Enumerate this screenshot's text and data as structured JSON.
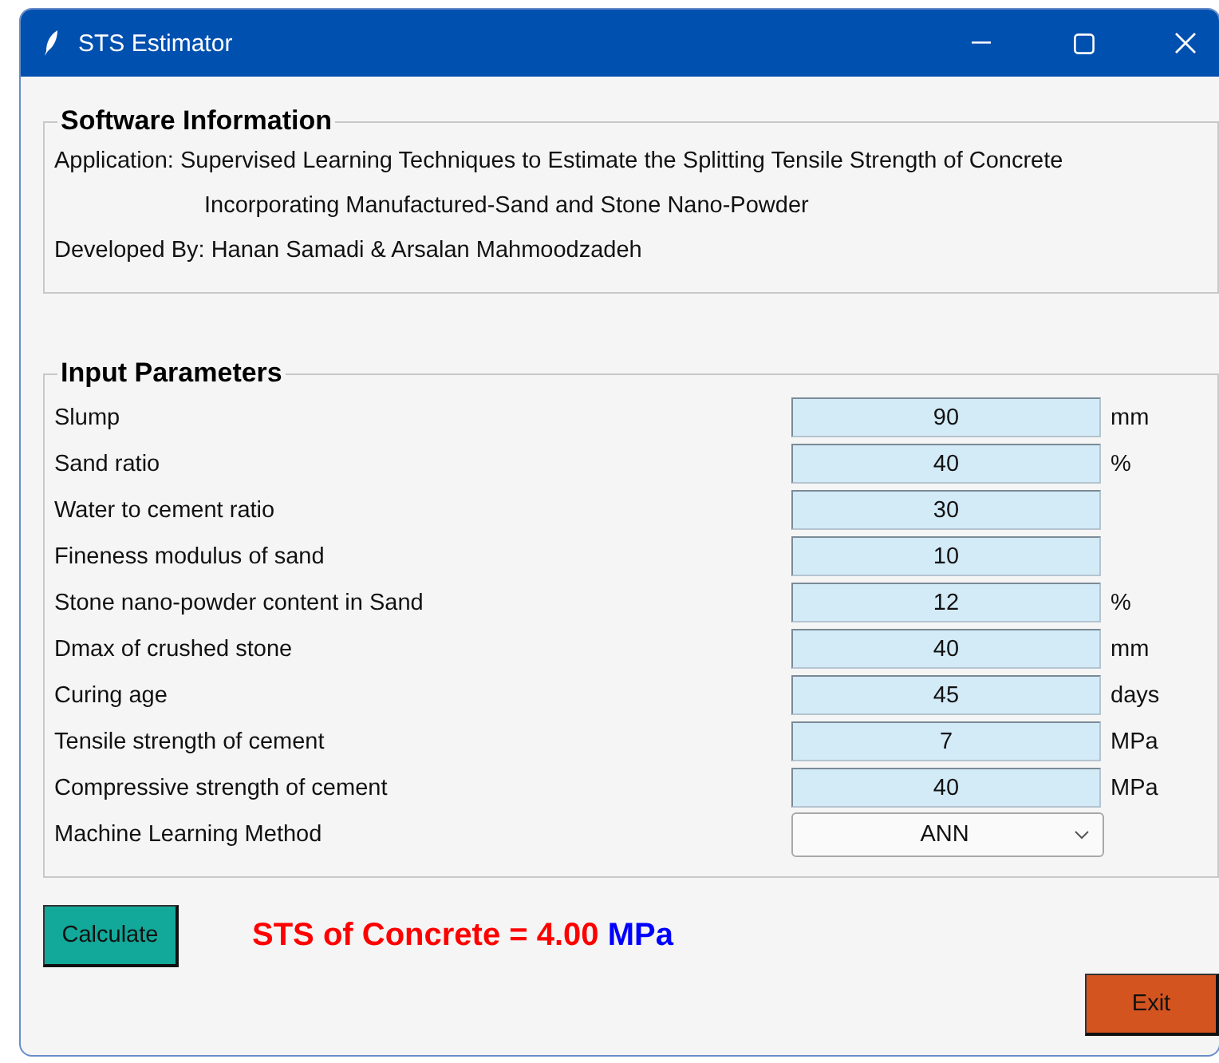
{
  "window": {
    "title": "STS Estimator"
  },
  "software_information": {
    "title": "Software Information",
    "lines": [
      {
        "kind": "first",
        "text": "Application: Supervised Learning Techniques to Estimate the Splitting Tensile Strength of Concrete"
      },
      {
        "kind": "indented",
        "text": "Incorporating Manufactured-Sand and Stone Nano-Powder"
      },
      {
        "kind": "first",
        "text": "Developed By: Hanan Samadi & Arsalan Mahmoodzadeh"
      }
    ]
  },
  "input_parameters": {
    "title": "Input Parameters",
    "rows": [
      {
        "kind": "entry",
        "label": "Slump",
        "value": "90",
        "unit": "mm"
      },
      {
        "kind": "entry",
        "label": "Sand ratio",
        "value": "40",
        "unit": "%"
      },
      {
        "kind": "entry",
        "label": "Water to cement ratio",
        "value": "30"
      },
      {
        "kind": "entry",
        "label": "Fineness modulus of sand",
        "value": "10"
      },
      {
        "kind": "entry",
        "label": "Stone nano-powder content in Sand",
        "value": "12",
        "unit": "%"
      },
      {
        "kind": "entry",
        "label": "Dmax of crushed stone",
        "value": "40",
        "unit": "mm"
      },
      {
        "kind": "entry",
        "label": "Curing age",
        "value": "45",
        "unit": "days"
      },
      {
        "kind": "entry",
        "label": "Tensile strength of cement",
        "value": "7",
        "unit": "MPa"
      },
      {
        "kind": "entry",
        "label": "Compressive strength of cement",
        "value": "40",
        "unit": "MPa"
      },
      {
        "kind": "dropdown",
        "label": "Machine Learning Method",
        "value": "ANN"
      }
    ]
  },
  "calculate_button": "Calculate",
  "result": {
    "text": "STS of Concrete = 4.00",
    "unit": "MPa"
  },
  "exit_button": "Exit"
}
